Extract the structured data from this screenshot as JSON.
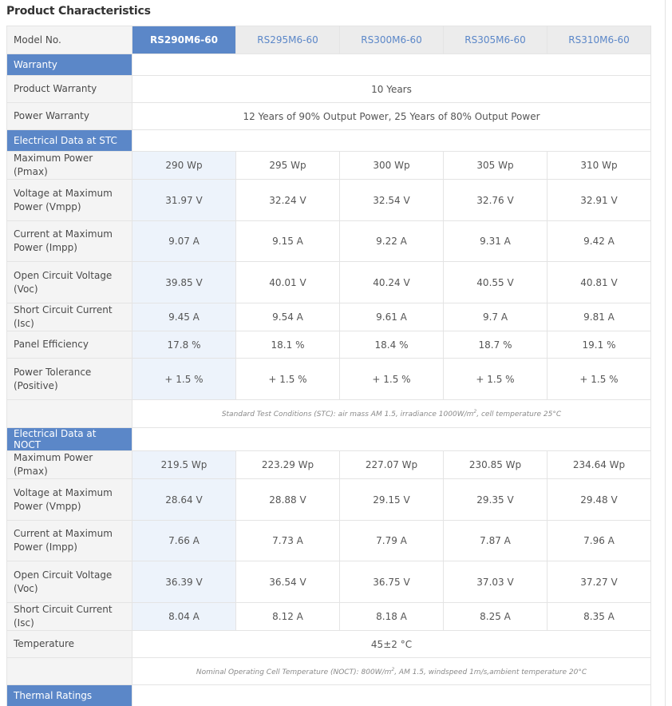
{
  "page": {
    "title": "Product Characteristics"
  },
  "header": {
    "label": "Model No.",
    "models": [
      "RS290M6-60",
      "RS295M6-60",
      "RS300M6-60",
      "RS305M6-60",
      "RS310M6-60"
    ]
  },
  "warranty": {
    "title": "Warranty",
    "rows": [
      {
        "label": "Product Warranty",
        "value": "10 Years"
      },
      {
        "label": "Power Warranty",
        "value": "12 Years of 90% Output Power, 25 Years of 80% Output Power"
      }
    ]
  },
  "stc": {
    "title": "Electrical Data at STC",
    "rows": [
      {
        "label": "Maximum Power (Pmax)",
        "values": [
          "290 Wp",
          "295 Wp",
          "300 Wp",
          "305 Wp",
          "310 Wp"
        ]
      },
      {
        "label": "Voltage at Maximum Power (Vmpp)",
        "values": [
          "31.97 V",
          "32.24 V",
          "32.54 V",
          "32.76 V",
          "32.91 V"
        ]
      },
      {
        "label": "Current at Maximum Power (Impp)",
        "values": [
          "9.07 A",
          "9.15 A",
          "9.22 A",
          "9.31 A",
          "9.42 A"
        ]
      },
      {
        "label": "Open Circuit Voltage (Voc)",
        "values": [
          "39.85 V",
          "40.01 V",
          "40.24 V",
          "40.55 V",
          "40.81 V"
        ]
      },
      {
        "label": "Short Circuit Current (Isc)",
        "values": [
          "9.45 A",
          "9.54 A",
          "9.61 A",
          "9.7 A",
          "9.81 A"
        ]
      },
      {
        "label": "Panel Efficiency",
        "values": [
          "17.8 %",
          "18.1 %",
          "18.4 %",
          "18.7 %",
          "19.1 %"
        ]
      },
      {
        "label": "Power Tolerance (Positive)",
        "values": [
          "+ 1.5 %",
          "+ 1.5 %",
          "+ 1.5 %",
          "+ 1.5 %",
          "+ 1.5 %"
        ]
      }
    ],
    "note_a": "Standard Test Conditions (STC): air mass AM 1.5, irradiance 1000W/m",
    "note_sup": "2",
    "note_b": ", cell temperature 25°C"
  },
  "noct": {
    "title": "Electrical Data at NOCT",
    "rows": [
      {
        "label": "Maximum Power (Pmax)",
        "values": [
          "219.5 Wp",
          "223.29 Wp",
          "227.07 Wp",
          "230.85 Wp",
          "234.64 Wp"
        ]
      },
      {
        "label": "Voltage at Maximum Power (Vmpp)",
        "values": [
          "28.64 V",
          "28.88 V",
          "29.15 V",
          "29.35 V",
          "29.48 V"
        ]
      },
      {
        "label": "Current at Maximum Power (Impp)",
        "values": [
          "7.66 A",
          "7.73 A",
          "7.79 A",
          "7.87 A",
          "7.96 A"
        ]
      },
      {
        "label": "Open Circuit Voltage (Voc)",
        "values": [
          "36.39 V",
          "36.54 V",
          "36.75 V",
          "37.03 V",
          "37.27 V"
        ]
      },
      {
        "label": "Short Circuit Current (Isc)",
        "values": [
          "8.04 A",
          "8.12 A",
          "8.18 A",
          "8.25 A",
          "8.35 A"
        ]
      }
    ],
    "temperature": {
      "label": "Temperature",
      "value": "45±2 °C"
    },
    "note_a": "Nominal Operating Cell Temperature (NOCT): 800W/m",
    "note_sup": "2",
    "note_b": ", AM 1.5, windspeed 1m/s,ambient temperature 20°C"
  },
  "thermal": {
    "title": "Thermal Ratings"
  },
  "colors": {
    "accent": "#5b87c8",
    "highlight_column": "#edf3fb",
    "label_bg": "#f4f4f4"
  }
}
